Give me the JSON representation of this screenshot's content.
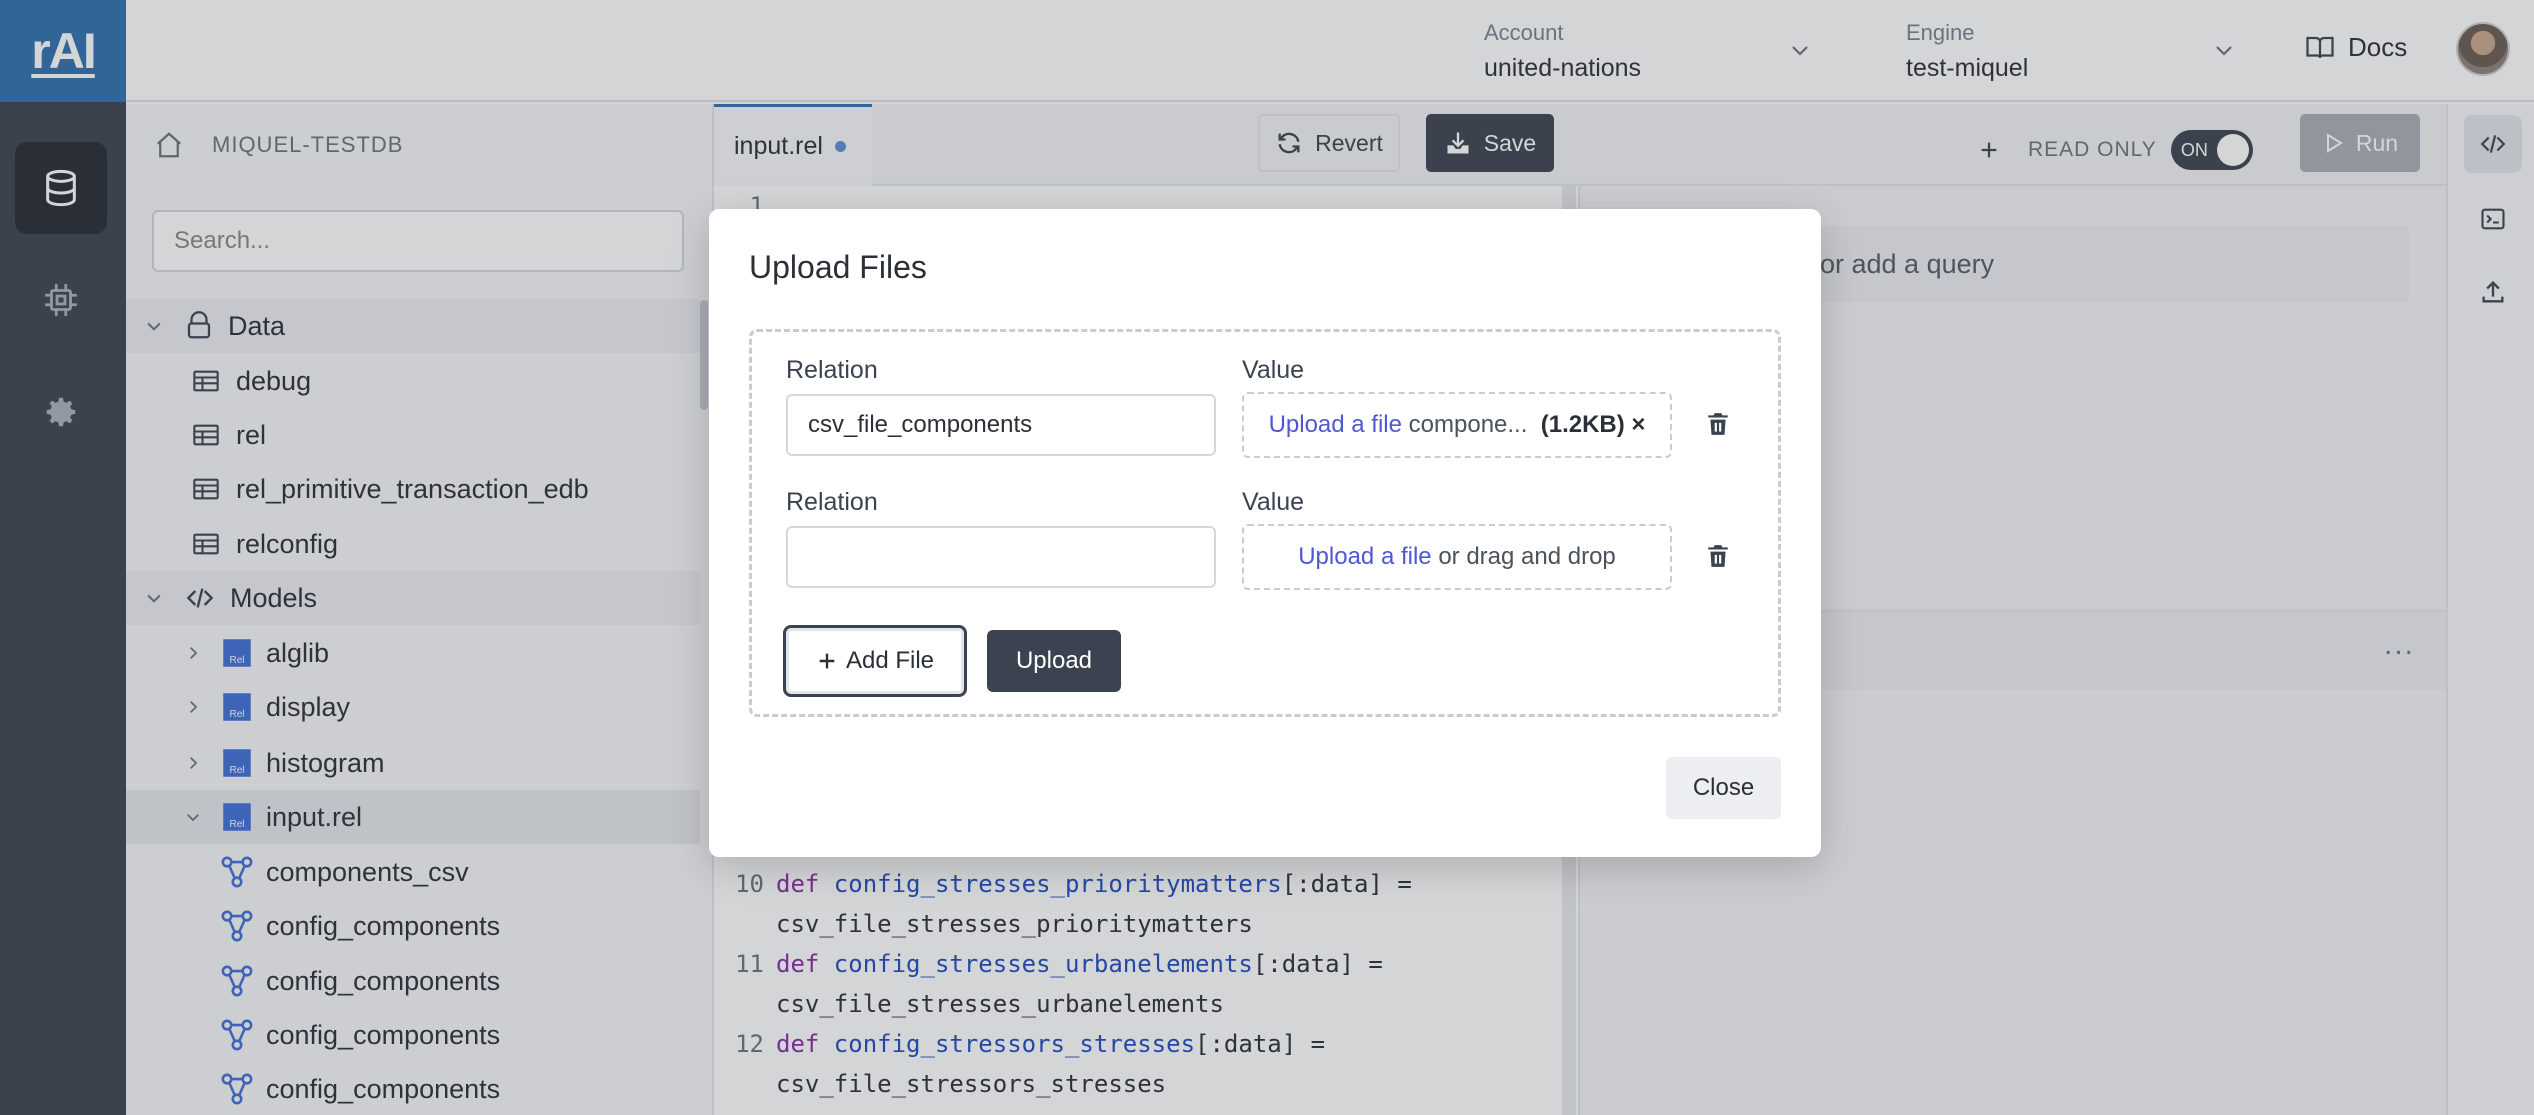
{
  "app": {
    "logo": "rAI"
  },
  "header": {
    "account_label": "Account",
    "account_value": "united-nations",
    "engine_label": "Engine",
    "engine_value": "test-miquel",
    "docs_label": "Docs"
  },
  "tree": {
    "db_name": "MIQUEL-TESTDB",
    "search_placeholder": "Search...",
    "data_section": "Data",
    "data_items": [
      "debug",
      "rel",
      "rel_primitive_transaction_edb",
      "relconfig"
    ],
    "models_section": "Models",
    "model_items": [
      "alglib",
      "display",
      "histogram",
      "input.rel"
    ],
    "input_children": [
      "components_csv",
      "config_components",
      "config_components",
      "config_components",
      "config_components"
    ]
  },
  "editor": {
    "tab_label": "input.rel",
    "revert_label": "Revert",
    "save_label": "Save",
    "first_line_number": "1",
    "lines": [
      {
        "num": "10",
        "kw": "def ",
        "fn": "config_stresses_prioritymatters",
        "rest": "[:data] ="
      },
      {
        "num": "",
        "kw": "",
        "fn": "",
        "rest": "csv_file_stresses_prioritymatters"
      },
      {
        "num": "11",
        "kw": "def ",
        "fn": "config_stresses_urbanelements",
        "rest": "[:data] ="
      },
      {
        "num": "",
        "kw": "",
        "fn": "",
        "rest": "csv_file_stresses_urbanelements"
      },
      {
        "num": "12",
        "kw": "def ",
        "fn": "config_stressors_stresses",
        "rest": "[:data] ="
      },
      {
        "num": "",
        "kw": "",
        "fn": "",
        "rest": "csv_file_stressors_stresses"
      }
    ]
  },
  "query": {
    "read_only_label": "READ ONLY",
    "toggle_label": "ON",
    "run_label": "Run",
    "add_query_text": "or add a query",
    "ellipsis": "..."
  },
  "modal": {
    "title": "Upload Files",
    "relation_label": "Relation",
    "value_label": "Value",
    "row1_relation": "csv_file_components",
    "row1_link": "Upload a file",
    "row1_filename": "compone...",
    "row1_size": "(1.2KB)",
    "row1_remove": "×",
    "row2_relation": "",
    "row2_link": "Upload a file",
    "row2_drop_text": "or drag and drop",
    "add_file_label": "Add File",
    "upload_label": "Upload",
    "close_label": "Close"
  },
  "colors": {
    "rail": "#3b4350",
    "logo_bg": "#2f6fae",
    "link": "#4f57d6",
    "primary_button": "#3b4350"
  }
}
